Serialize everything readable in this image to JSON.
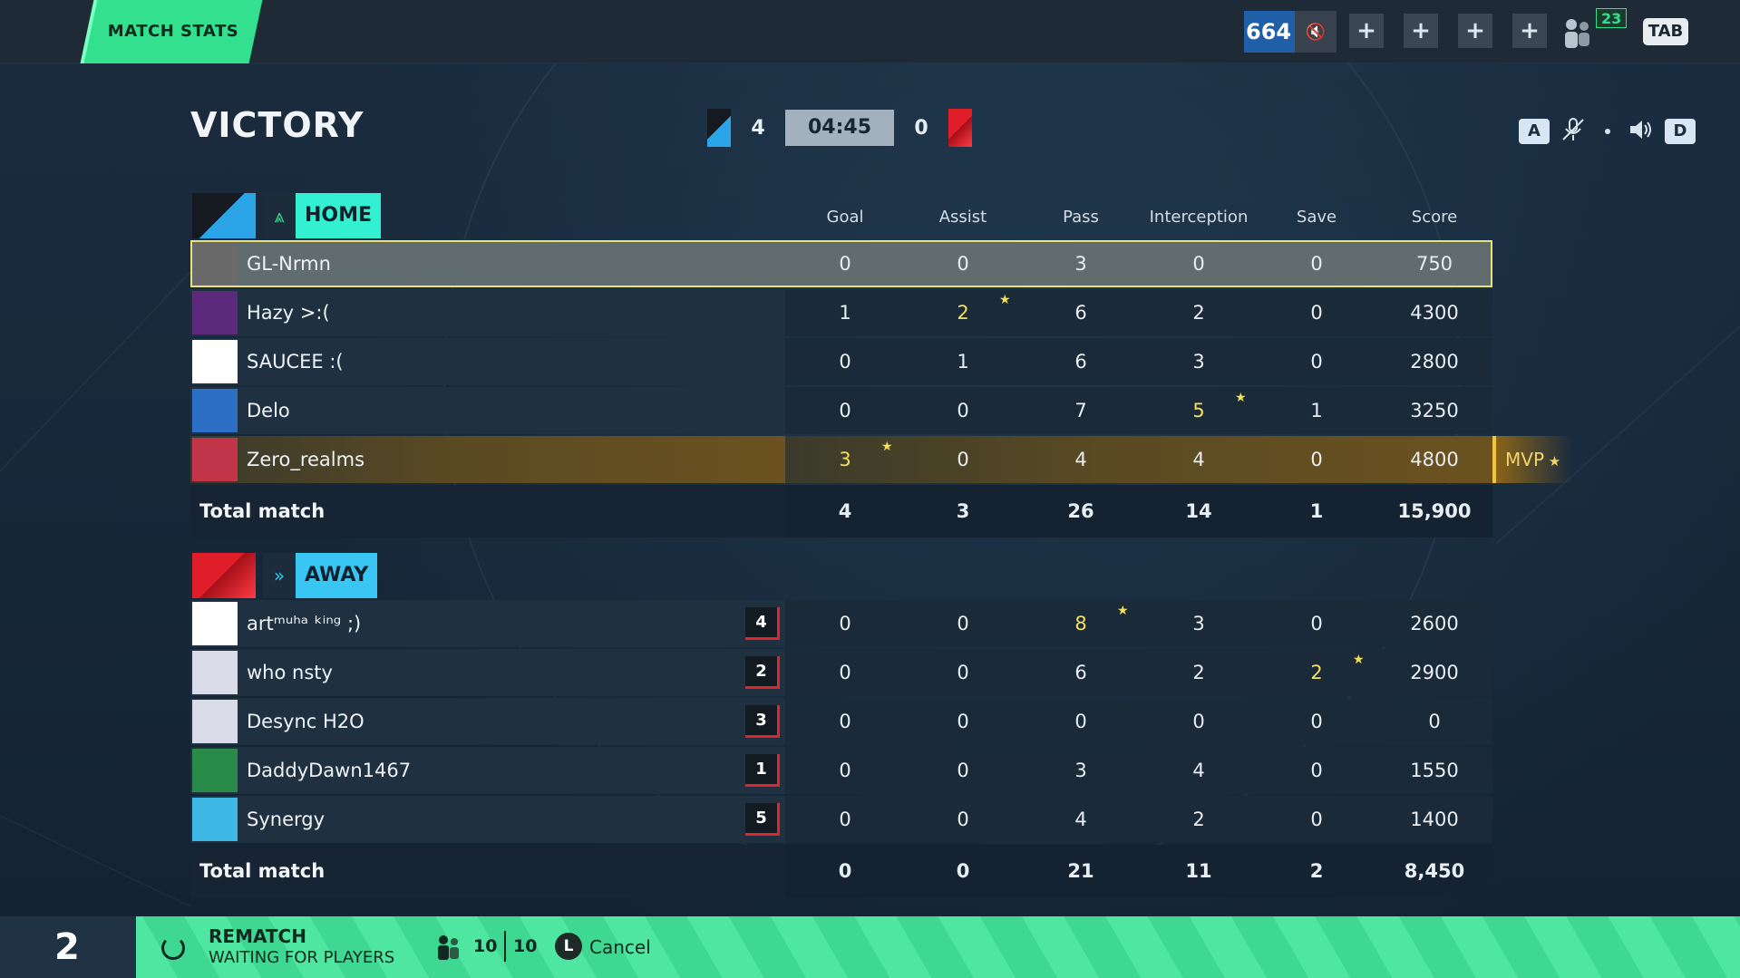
{
  "topbar": {
    "tab_label": "MATCH STATS",
    "level": "664",
    "friends_count": "23",
    "tab_key": "TAB"
  },
  "header": {
    "result": "VICTORY",
    "home_score": "4",
    "away_score": "0",
    "timer": "04:45",
    "key_a": "A",
    "key_d": "D"
  },
  "columns": [
    "Goal",
    "Assist",
    "Pass",
    "Interception",
    "Save",
    "Score"
  ],
  "home": {
    "team_name": "HOME",
    "players": [
      {
        "name": "GL-Nrmn",
        "stats": [
          "0",
          "0",
          "3",
          "0",
          "0",
          "750"
        ],
        "highlight": [],
        "selected": true,
        "avatar_color": "#6a6a6a"
      },
      {
        "name": "Hazy >:(",
        "stats": [
          "1",
          "2",
          "6",
          "2",
          "0",
          "4300"
        ],
        "highlight": [
          1
        ],
        "avatar_color": "#5b2a7a"
      },
      {
        "name": "SAUCEE :(",
        "stats": [
          "0",
          "1",
          "6",
          "3",
          "0",
          "2800"
        ],
        "highlight": [],
        "avatar_color": "#ffffff"
      },
      {
        "name": "Delo",
        "stats": [
          "0",
          "0",
          "7",
          "5",
          "1",
          "3250"
        ],
        "highlight": [
          3
        ],
        "avatar_color": "#2d6fc4"
      },
      {
        "name": "Zero_realms",
        "stats": [
          "3",
          "0",
          "4",
          "4",
          "0",
          "4800"
        ],
        "highlight": [
          0
        ],
        "mvp": true,
        "avatar_color": "#c2344a"
      }
    ],
    "total_label": "Total match",
    "totals": [
      "4",
      "3",
      "26",
      "14",
      "1",
      "15,900"
    ],
    "mvp_label": "MVP"
  },
  "away": {
    "team_name": "AWAY",
    "players": [
      {
        "name": "artᵐᵘʰᵃ ᵏⁱⁿᵍ ;)",
        "rank": "4",
        "stats": [
          "0",
          "0",
          "8",
          "3",
          "0",
          "2600"
        ],
        "highlight": [
          2
        ],
        "avatar_color": "#ffffff"
      },
      {
        "name": "who nsty",
        "rank": "2",
        "stats": [
          "0",
          "0",
          "6",
          "2",
          "2",
          "2900"
        ],
        "highlight": [
          4
        ],
        "avatar_color": "#d9dbe8"
      },
      {
        "name": "Desync H2O",
        "rank": "3",
        "stats": [
          "0",
          "0",
          "0",
          "0",
          "0",
          "0"
        ],
        "highlight": [],
        "avatar_color": "#d9dbe8"
      },
      {
        "name": "DaddyDawn1467",
        "rank": "1",
        "stats": [
          "0",
          "0",
          "3",
          "4",
          "0",
          "1550"
        ],
        "highlight": [],
        "avatar_color": "#2a8a4a"
      },
      {
        "name": "Synergy",
        "rank": "5",
        "stats": [
          "0",
          "0",
          "4",
          "2",
          "0",
          "1400"
        ],
        "highlight": [],
        "avatar_color": "#3fb8e6"
      }
    ],
    "total_label": "Total match",
    "totals": [
      "0",
      "0",
      "21",
      "11",
      "2",
      "8,450"
    ]
  },
  "bottom": {
    "party_count": "2",
    "rematch_title": "REMATCH",
    "rematch_sub": "WAITING FOR PLAYERS",
    "players_ready": "10",
    "players_total": "10",
    "cancel_key": "L",
    "cancel_label": "Cancel"
  }
}
